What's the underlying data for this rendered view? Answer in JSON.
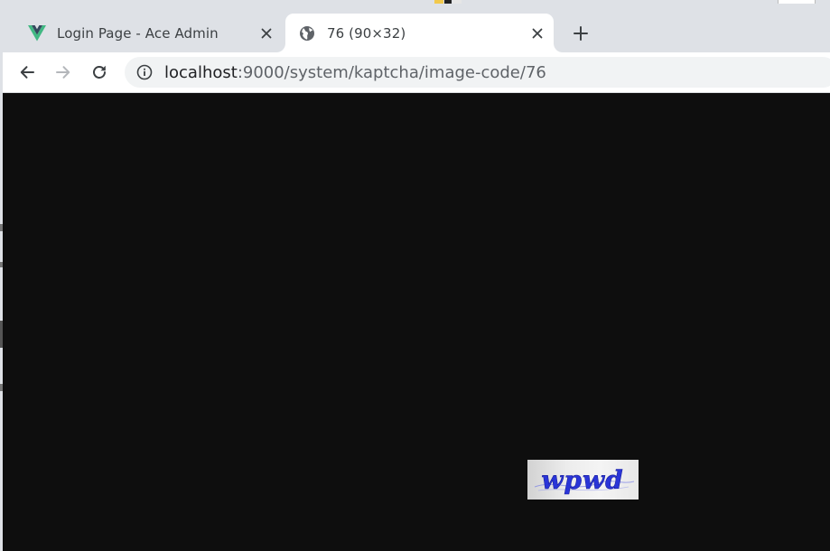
{
  "browser": {
    "tabs": [
      {
        "title": "Login Page - Ace Admin",
        "favicon": "vue-logo-icon",
        "active": false
      },
      {
        "title": "76 (90×32)",
        "favicon": "globe-icon",
        "active": true
      }
    ],
    "new_tab_icon": "plus-icon",
    "close_icon": "close-icon"
  },
  "toolbar": {
    "back_icon": "back-arrow-icon",
    "forward_icon": "forward-arrow-icon",
    "reload_icon": "reload-icon",
    "site_info_icon": "info-icon",
    "url_host": "localhost",
    "url_path": ":9000/system/kaptcha/image-code/76"
  },
  "content": {
    "captcha_text": "wpwd",
    "captcha_color": "#2a35d8",
    "background_color": "#0e0e0e"
  },
  "colors": {
    "tab_strip": "#dee1e6",
    "active_tab": "#ffffff",
    "omnibox": "#f1f3f4",
    "vue_green": "#41b883",
    "vue_dark": "#35495e"
  }
}
